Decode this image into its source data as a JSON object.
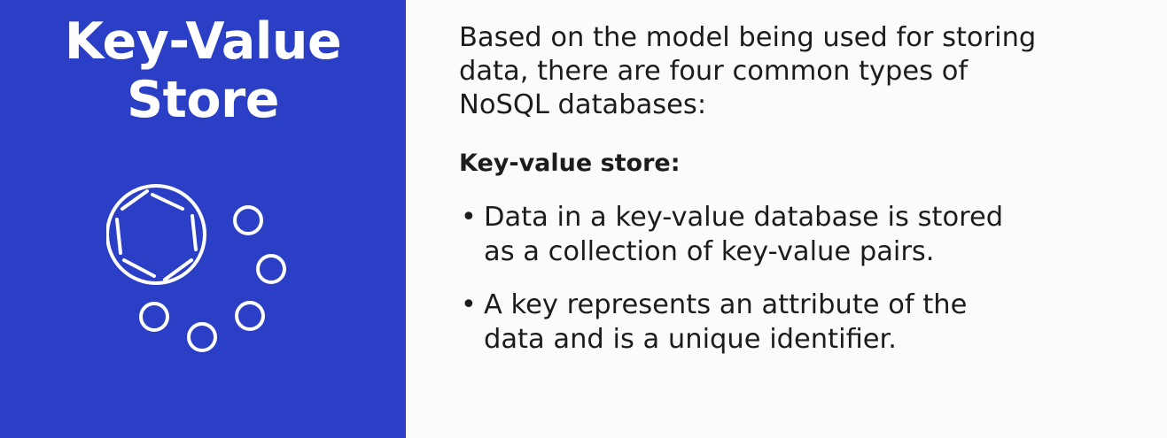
{
  "left_panel": {
    "title_line1": "Key-Value",
    "title_line2": "Store",
    "icon": "key-value-store-icon",
    "background": "#2b3fc6"
  },
  "right_panel": {
    "intro_line1": "Based on the model being used for storing",
    "intro_line2": "data, there are four common types of",
    "intro_line3": "NoSQL databases:",
    "subheading": "Key-value store:",
    "bullets": [
      {
        "line1": "Data in a key-value database is stored",
        "line2": "as a collection of key-value pairs."
      },
      {
        "line1": "A key represents an attribute of the",
        "line2": "data and is a unique identifier."
      }
    ]
  }
}
